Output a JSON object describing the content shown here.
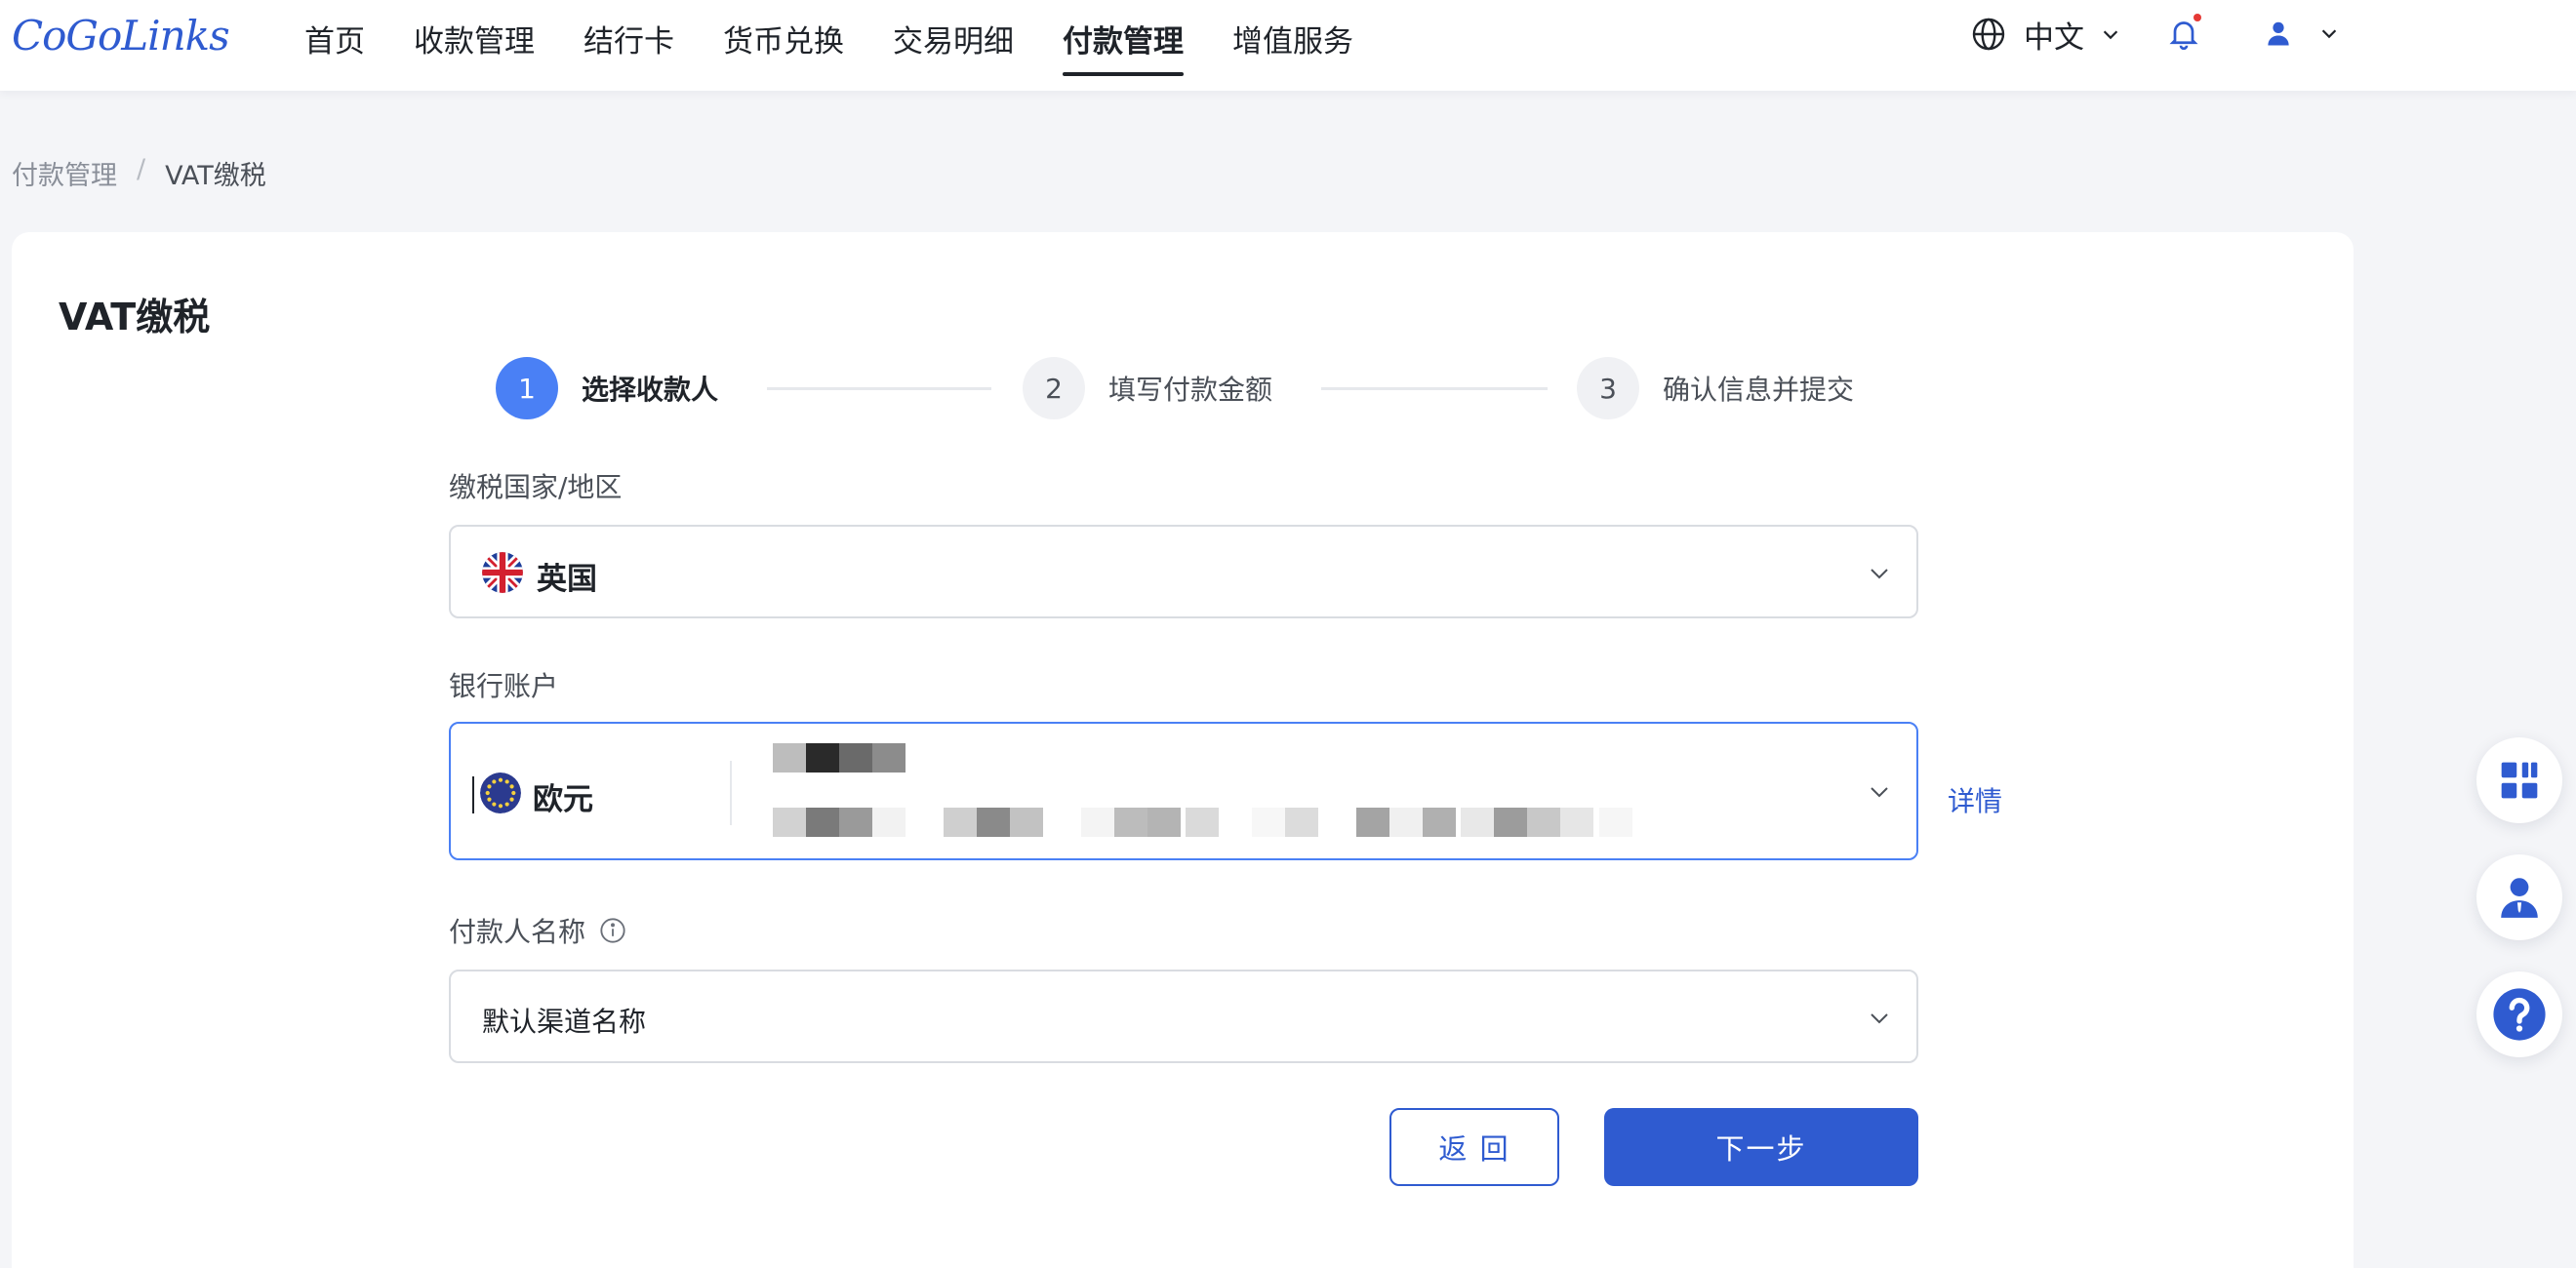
{
  "brand": {
    "logo_text": "CoGoLinks",
    "accent": "#2f5bd0"
  },
  "nav": {
    "items": [
      {
        "label": "首页"
      },
      {
        "label": "收款管理"
      },
      {
        "label": "结行卡"
      },
      {
        "label": "货币兑换"
      },
      {
        "label": "交易明细"
      },
      {
        "label": "付款管理",
        "active": true
      },
      {
        "label": "增值服务"
      }
    ]
  },
  "header": {
    "language": "中文",
    "icons": [
      "globe-icon",
      "bell-icon",
      "user-icon"
    ],
    "has_notification": true
  },
  "breadcrumb": {
    "parent": "付款管理",
    "separator": "/",
    "current": "VAT缴税"
  },
  "page": {
    "title": "VAT缴税"
  },
  "steps": [
    {
      "number": "1",
      "label": "选择收款人",
      "active": true
    },
    {
      "number": "2",
      "label": "填写付款金额",
      "active": false
    },
    {
      "number": "3",
      "label": "确认信息并提交",
      "active": false
    }
  ],
  "form": {
    "country": {
      "label": "缴税国家/地区",
      "value": "英国",
      "flag": "uk-flag-icon"
    },
    "bank_account": {
      "label": "银行账户",
      "currency": "欧元",
      "flag": "eu-flag-icon",
      "details_link": "详情",
      "masked": true
    },
    "payer_name": {
      "label": "付款人名称",
      "value": "默认渠道名称",
      "info_icon": "info-icon"
    }
  },
  "buttons": {
    "back": "返 回",
    "next": "下一步"
  },
  "floating": [
    "apps-grid-icon",
    "customer-service-icon",
    "help-icon"
  ]
}
